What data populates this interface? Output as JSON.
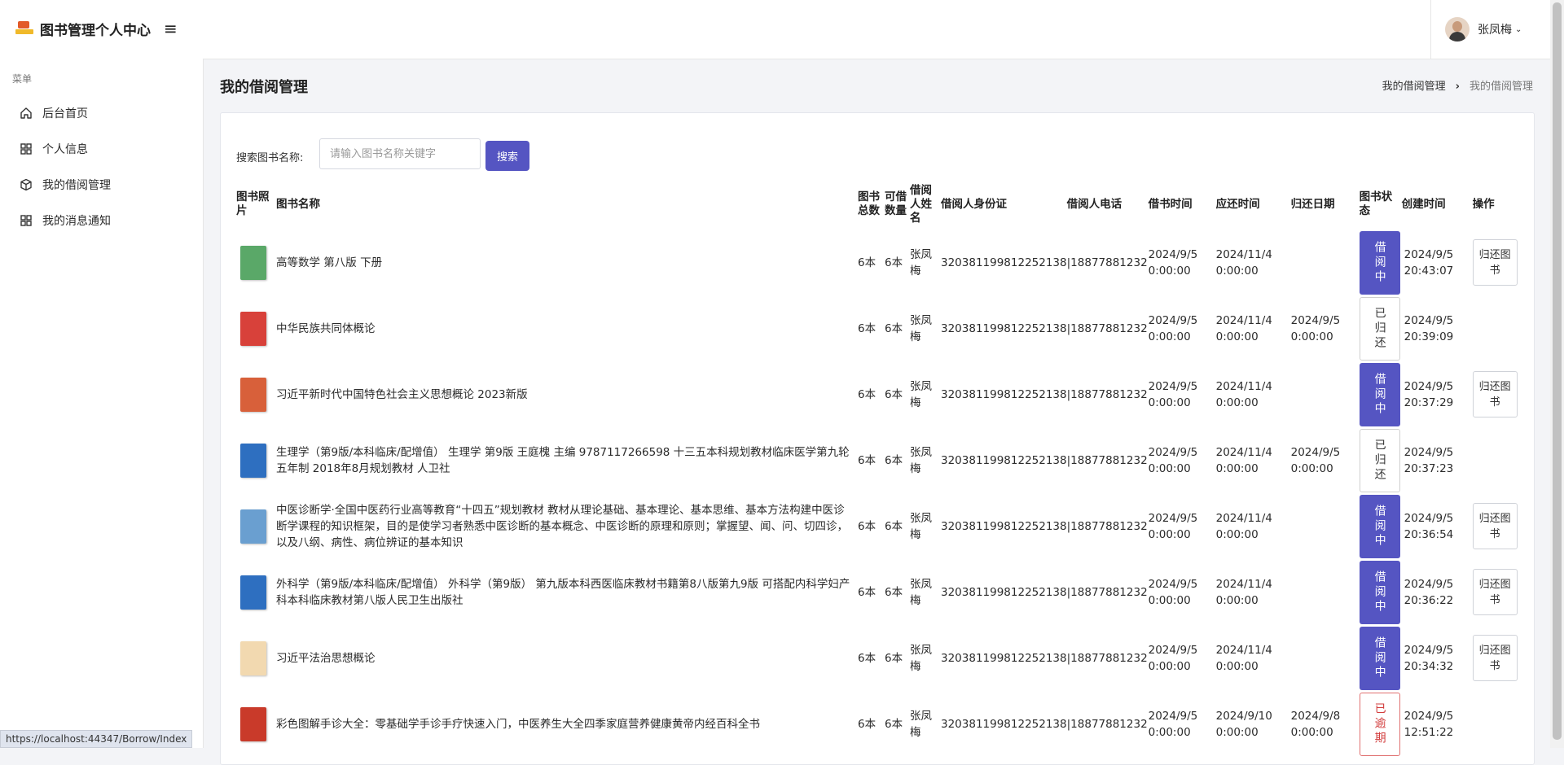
{
  "app": {
    "title": "图书管理个人中心",
    "menu_header": "菜单"
  },
  "sidebar": {
    "items": [
      {
        "label": "后台首页",
        "icon": "home-icon"
      },
      {
        "label": "个人信息",
        "icon": "grid-icon"
      },
      {
        "label": "我的借阅管理",
        "icon": "cube-icon"
      },
      {
        "label": "我的消息通知",
        "icon": "grid-icon"
      }
    ]
  },
  "user": {
    "name": "张凤梅"
  },
  "page": {
    "title": "我的借阅管理",
    "breadcrumb": [
      "我的借阅管理",
      "我的借阅管理"
    ]
  },
  "search": {
    "label": "搜索图书名称:",
    "placeholder": "请输入图书名称关键字",
    "button": "搜索"
  },
  "table": {
    "headers": [
      "图书照片",
      "图书名称",
      "图书总数",
      "可借数量",
      "借阅人姓名",
      "借阅人身份证",
      "借阅人电话",
      "借书时间",
      "应还时间",
      "归还日期",
      "图书状态",
      "创建时间",
      "操作"
    ],
    "rows": [
      {
        "name": "高等数学 第八版 下册",
        "total": "6本",
        "available": "6本",
        "borrower": "张凤梅",
        "id_card": "320381199812252138",
        "phone": "18877881232",
        "borrow_time": "2024/9/5 0:00:00",
        "due_time": "2024/11/4 0:00:00",
        "return_date": "",
        "status": "借阅中",
        "status_type": "borrowing",
        "created": "2024/9/5 20:43:07",
        "action": "归还图书"
      },
      {
        "name": "中华民族共同体概论",
        "total": "6本",
        "available": "6本",
        "borrower": "张凤梅",
        "id_card": "320381199812252138",
        "phone": "18877881232",
        "borrow_time": "2024/9/5 0:00:00",
        "due_time": "2024/11/4 0:00:00",
        "return_date": "2024/9/5 0:00:00",
        "status": "已归还",
        "status_type": "returned",
        "created": "2024/9/5 20:39:09",
        "action": ""
      },
      {
        "name": "习近平新时代中国特色社会主义思想概论 2023新版",
        "total": "6本",
        "available": "6本",
        "borrower": "张凤梅",
        "id_card": "320381199812252138",
        "phone": "18877881232",
        "borrow_time": "2024/9/5 0:00:00",
        "due_time": "2024/11/4 0:00:00",
        "return_date": "",
        "status": "借阅中",
        "status_type": "borrowing",
        "created": "2024/9/5 20:37:29",
        "action": "归还图书"
      },
      {
        "name": "生理学（第9版/本科临床/配增值） 生理学 第9版 王庭槐 主编 9787117266598 十三五本科规划教材临床医学第九轮五年制 2018年8月规划教材 人卫社",
        "total": "6本",
        "available": "6本",
        "borrower": "张凤梅",
        "id_card": "320381199812252138",
        "phone": "18877881232",
        "borrow_time": "2024/9/5 0:00:00",
        "due_time": "2024/11/4 0:00:00",
        "return_date": "2024/9/5 0:00:00",
        "status": "已归还",
        "status_type": "returned",
        "created": "2024/9/5 20:37:23",
        "action": ""
      },
      {
        "name": "中医诊断学·全国中医药行业高等教育“十四五”规划教材 教材从理论基础、基本理论、基本思维、基本方法构建中医诊断学课程的知识框架，目的是使学习者熟悉中医诊断的基本概念、中医诊断的原理和原则；掌握望、闻、问、切四诊，以及八纲、病性、病位辨证的基本知识",
        "total": "6本",
        "available": "6本",
        "borrower": "张凤梅",
        "id_card": "320381199812252138",
        "phone": "18877881232",
        "borrow_time": "2024/9/5 0:00:00",
        "due_time": "2024/11/4 0:00:00",
        "return_date": "",
        "status": "借阅中",
        "status_type": "borrowing",
        "created": "2024/9/5 20:36:54",
        "action": "归还图书"
      },
      {
        "name": "外科学（第9版/本科临床/配增值） 外科学（第9版） 第九版本科西医临床教材书籍第8八版第九9版 可搭配内科学妇产科本科临床教材第八版人民卫生出版社",
        "total": "6本",
        "available": "6本",
        "borrower": "张凤梅",
        "id_card": "320381199812252138",
        "phone": "18877881232",
        "borrow_time": "2024/9/5 0:00:00",
        "due_time": "2024/11/4 0:00:00",
        "return_date": "",
        "status": "借阅中",
        "status_type": "borrowing",
        "created": "2024/9/5 20:36:22",
        "action": "归还图书"
      },
      {
        "name": "习近平法治思想概论",
        "total": "6本",
        "available": "6本",
        "borrower": "张凤梅",
        "id_card": "320381199812252138",
        "phone": "18877881232",
        "borrow_time": "2024/9/5 0:00:00",
        "due_time": "2024/11/4 0:00:00",
        "return_date": "",
        "status": "借阅中",
        "status_type": "borrowing",
        "created": "2024/9/5 20:34:32",
        "action": "归还图书"
      },
      {
        "name": "彩色图解手诊大全：零基础学手诊手疗快速入门，中医养生大全四季家庭营养健康黄帝内经百科全书",
        "total": "6本",
        "available": "6本",
        "borrower": "张凤梅",
        "id_card": "320381199812252138",
        "phone": "18877881232",
        "borrow_time": "2024/9/5 0:00:00",
        "due_time": "2024/9/10 0:00:00",
        "return_date": "2024/9/8 0:00:00",
        "status": "已逾期",
        "status_type": "overdue",
        "created": "2024/9/5 12:51:22",
        "action": ""
      }
    ]
  },
  "colors": {
    "accent": "#5555c2",
    "overdue": "#d23c3c"
  },
  "status_bar": {
    "url": "https://localhost:44347/Borrow/Index"
  }
}
